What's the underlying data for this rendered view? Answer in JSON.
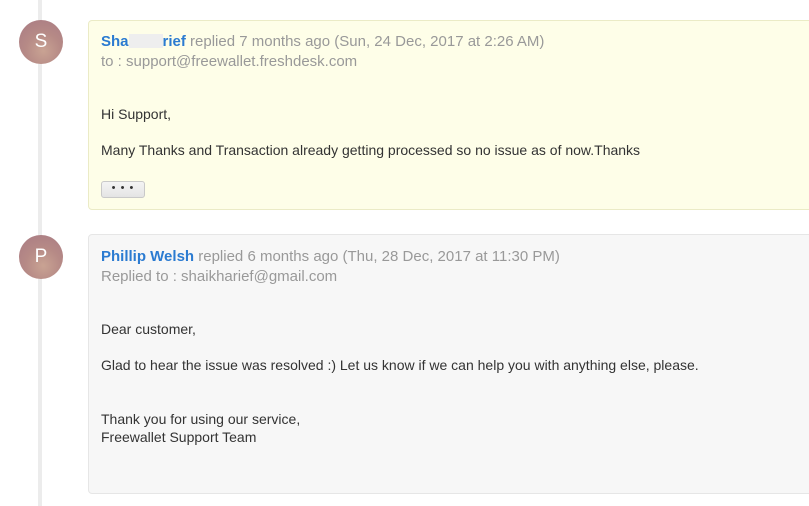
{
  "conversation": {
    "customer_reply": {
      "avatar_letter": "S",
      "author_prefix": "Sha",
      "author_suffix": "rief",
      "reply_info": "replied 7 months ago (Sun, 24 Dec, 2017 at 2:26 AM)",
      "to_line": "to : support@freewallet.freshdesk.com",
      "greeting": "Hi Support,",
      "message": "Many Thanks and Transaction already getting processed so no issue as of now.Thanks",
      "expand_label": "• • •"
    },
    "agent_reply": {
      "avatar_letter": "P",
      "author": "Phillip Welsh",
      "reply_info": "replied 6 months ago (Thu, 28 Dec, 2017 at 11:30 PM)",
      "to_line": "Replied to : shaikharief@gmail.com",
      "greeting": "Dear customer,",
      "message": "Glad to hear the issue was resolved :) Let us know if we can help you with anything else, please.",
      "closing_1": "Thank you for using our service,",
      "closing_2": "Freewallet Support Team"
    }
  },
  "colors": {
    "author_link": "#2b7bd1",
    "customer_card_bg": "#fefee8",
    "agent_card_bg": "#f7f7f7",
    "muted_text": "#999999"
  }
}
